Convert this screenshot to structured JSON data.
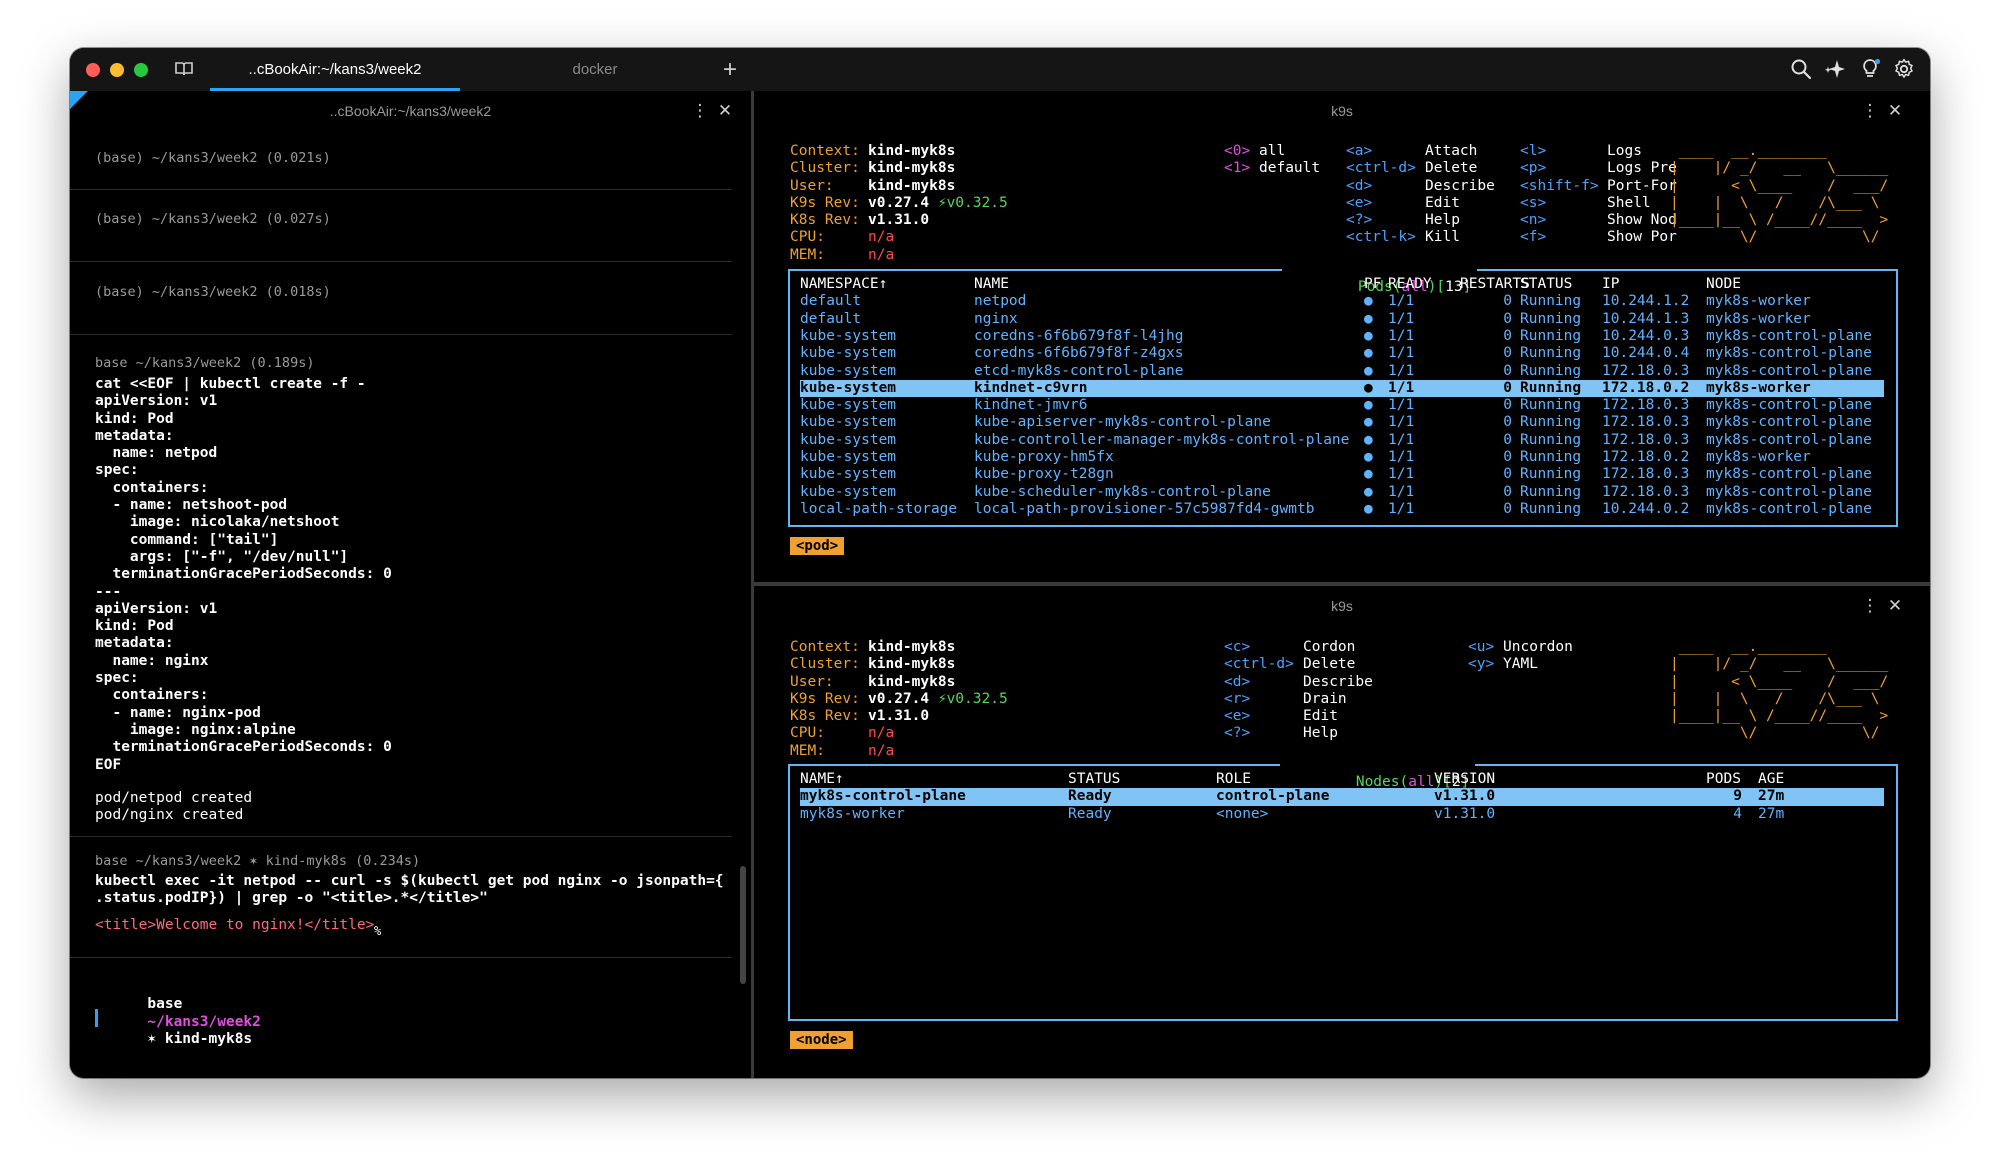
{
  "titlebar": {
    "tabs": [
      {
        "label": "..cBookAir:~/kans3/week2",
        "active": true
      },
      {
        "label": "docker",
        "active": false
      }
    ],
    "new_tab": "+"
  },
  "left_pane": {
    "title": "..cBookAir:~/kans3/week2",
    "blocks": [
      {
        "prompt": "(base) ~/kans3/week2 (0.021s)"
      },
      {
        "prompt": "(base) ~/kans3/week2 (0.027s)"
      },
      {
        "prompt": "(base) ~/kans3/week2 (0.018s)"
      },
      {
        "prompt": "base ~/kans3/week2 (0.189s)",
        "command": [
          "cat <<EOF | kubectl create -f -",
          "apiVersion: v1",
          "kind: Pod",
          "metadata:",
          "  name: netpod",
          "spec:",
          "  containers:",
          "  - name: netshoot-pod",
          "    image: nicolaka/netshoot",
          "    command: [\"tail\"]",
          "    args: [\"-f\", \"/dev/null\"]",
          "  terminationGracePeriodSeconds: 0",
          "---",
          "apiVersion: v1",
          "kind: Pod",
          "metadata:",
          "  name: nginx",
          "spec:",
          "  containers:",
          "  - name: nginx-pod",
          "    image: nginx:alpine",
          "  terminationGracePeriodSeconds: 0",
          "EOF"
        ],
        "output": [
          "pod/netpod created",
          "pod/nginx created"
        ]
      },
      {
        "prompt": "base ~/kans3/week2 ✶ kind-myk8s (0.234s)",
        "command": [
          "kubectl exec -it netpod -- curl -s $(kubectl get pod nginx -o jsonpath={",
          ".status.podIP}) | grep -o \"<title>.*</title>\""
        ],
        "output_highlight": "<title>Welcome to nginx!</title>",
        "output_mark": "%"
      }
    ],
    "current_prompt": {
      "env": "base",
      "path": "~/kans3/week2",
      "context": "✶ kind-myk8s"
    }
  },
  "k9s_pods": {
    "title": "k9s",
    "info": {
      "labels": [
        "Context:",
        "Cluster:",
        "User:",
        "K9s Rev:",
        "K8s Rev:",
        "CPU:",
        "MEM:"
      ],
      "values": [
        "kind-myk8s",
        "kind-myk8s",
        "kind-myk8s",
        "v0.27.4",
        "v1.31.0",
        "n/a",
        "n/a"
      ],
      "k9s_latest": "⚡v0.32.5"
    },
    "namespaces": [
      {
        "key": "<0>",
        "label": "all"
      },
      {
        "key": "<1>",
        "label": "default"
      }
    ],
    "hotkeys_col1": [
      {
        "key": "<a>",
        "label": "Attach"
      },
      {
        "key": "<ctrl-d>",
        "label": "Delete"
      },
      {
        "key": "<d>",
        "label": "Describe"
      },
      {
        "key": "<e>",
        "label": "Edit"
      },
      {
        "key": "<?>",
        "label": "Help"
      },
      {
        "key": "<ctrl-k>",
        "label": "Kill"
      }
    ],
    "hotkeys_col2": [
      {
        "key": "<l>",
        "label": "Logs"
      },
      {
        "key": "<p>",
        "label": "Logs Pre"
      },
      {
        "key": "<shift-f>",
        "label": "Port-For"
      },
      {
        "key": "<s>",
        "label": "Shell"
      },
      {
        "key": "<n>",
        "label": "Show Nod"
      },
      {
        "key": "<f>",
        "label": "Show Por"
      }
    ],
    "table": {
      "resource": "Pods",
      "scope": "all",
      "count": "13",
      "columns": [
        "NAMESPACE↑",
        "NAME",
        "PF",
        "READY",
        "RESTARTS",
        "STATUS",
        "IP",
        "NODE"
      ],
      "selected_index": 5,
      "rows": [
        [
          "default",
          "netpod",
          "●",
          "1/1",
          "0",
          "Running",
          "10.244.1.2",
          "myk8s-worker"
        ],
        [
          "default",
          "nginx",
          "●",
          "1/1",
          "0",
          "Running",
          "10.244.1.3",
          "myk8s-worker"
        ],
        [
          "kube-system",
          "coredns-6f6b679f8f-l4jhg",
          "●",
          "1/1",
          "0",
          "Running",
          "10.244.0.3",
          "myk8s-control-plane"
        ],
        [
          "kube-system",
          "coredns-6f6b679f8f-z4gxs",
          "●",
          "1/1",
          "0",
          "Running",
          "10.244.0.4",
          "myk8s-control-plane"
        ],
        [
          "kube-system",
          "etcd-myk8s-control-plane",
          "●",
          "1/1",
          "0",
          "Running",
          "172.18.0.3",
          "myk8s-control-plane"
        ],
        [
          "kube-system",
          "kindnet-c9vrn",
          "●",
          "1/1",
          "0",
          "Running",
          "172.18.0.2",
          "myk8s-worker"
        ],
        [
          "kube-system",
          "kindnet-jmvr6",
          "●",
          "1/1",
          "0",
          "Running",
          "172.18.0.3",
          "myk8s-control-plane"
        ],
        [
          "kube-system",
          "kube-apiserver-myk8s-control-plane",
          "●",
          "1/1",
          "0",
          "Running",
          "172.18.0.3",
          "myk8s-control-plane"
        ],
        [
          "kube-system",
          "kube-controller-manager-myk8s-control-plane",
          "●",
          "1/1",
          "0",
          "Running",
          "172.18.0.3",
          "myk8s-control-plane"
        ],
        [
          "kube-system",
          "kube-proxy-hm5fx",
          "●",
          "1/1",
          "0",
          "Running",
          "172.18.0.2",
          "myk8s-worker"
        ],
        [
          "kube-system",
          "kube-proxy-t28gn",
          "●",
          "1/1",
          "0",
          "Running",
          "172.18.0.3",
          "myk8s-control-plane"
        ],
        [
          "kube-system",
          "kube-scheduler-myk8s-control-plane",
          "●",
          "1/1",
          "0",
          "Running",
          "172.18.0.3",
          "myk8s-control-plane"
        ],
        [
          "local-path-storage",
          "local-path-provisioner-57c5987fd4-gwmtb",
          "●",
          "1/1",
          "0",
          "Running",
          "10.244.0.2",
          "myk8s-control-plane"
        ]
      ]
    },
    "crumb": "<pod>"
  },
  "k9s_nodes": {
    "title": "k9s",
    "info": {
      "labels": [
        "Context:",
        "Cluster:",
        "User:",
        "K9s Rev:",
        "K8s Rev:",
        "CPU:",
        "MEM:"
      ],
      "values": [
        "kind-myk8s",
        "kind-myk8s",
        "kind-myk8s",
        "v0.27.4",
        "v1.31.0",
        "n/a",
        "n/a"
      ],
      "k9s_latest": "⚡v0.32.5"
    },
    "hotkeys_col1": [
      {
        "key": "<c>",
        "label": "Cordon"
      },
      {
        "key": "<ctrl-d>",
        "label": "Delete"
      },
      {
        "key": "<d>",
        "label": "Describe"
      },
      {
        "key": "<r>",
        "label": "Drain"
      },
      {
        "key": "<e>",
        "label": "Edit"
      },
      {
        "key": "<?>",
        "label": "Help"
      }
    ],
    "hotkeys_col2": [
      {
        "key": "<u>",
        "label": "Uncordon"
      },
      {
        "key": "<y>",
        "label": "YAML"
      }
    ],
    "table": {
      "resource": "Nodes",
      "scope": "all",
      "count": "2",
      "columns": [
        "NAME↑",
        "STATUS",
        "ROLE",
        "VERSION",
        "PODS",
        "AGE"
      ],
      "selected_index": 0,
      "rows": [
        [
          "myk8s-control-plane",
          "Ready",
          "control-plane",
          "v1.31.0",
          "9",
          "27m"
        ],
        [
          "myk8s-worker",
          "Ready",
          "<none>",
          "v1.31.0",
          "4",
          "27m"
        ]
      ]
    },
    "crumb": "<node>"
  },
  "logo_ascii": [
    " ____  __.________       ",
    "|    |/ _/   __   \\______",
    "|      < \\____    /  ___/",
    "|    |  \\   /    /\\___ \\ ",
    "|____|__ \\ /____//____  >",
    "        \\/            \\/ "
  ],
  "colors": {
    "accent": "#2aa3f0",
    "k9s_label": "#f0a030",
    "k9s_table_border": "#5fb7f5",
    "selection": "#7fc4f4",
    "highlight_output": "#ff6a7a"
  }
}
